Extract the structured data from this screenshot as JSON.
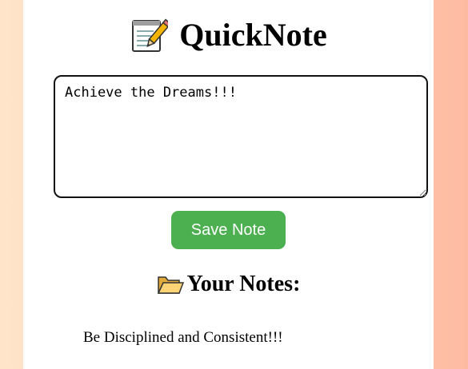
{
  "app": {
    "title": "QuickNote",
    "title_icon": "memo-icon"
  },
  "editor": {
    "value": "Achieve the Dreams!!!",
    "placeholder": ""
  },
  "actions": {
    "save_label": "Save Note"
  },
  "notes_section": {
    "heading": "Your Notes:",
    "heading_icon": "open-folder-icon",
    "items": [
      {
        "text": "Be Disciplined and Consistent!!!"
      }
    ]
  },
  "colors": {
    "accent": "#4caf50",
    "card_bg": "#ffffff",
    "bg_left": "#ffe4c9",
    "bg_right": "#fdbba2"
  }
}
